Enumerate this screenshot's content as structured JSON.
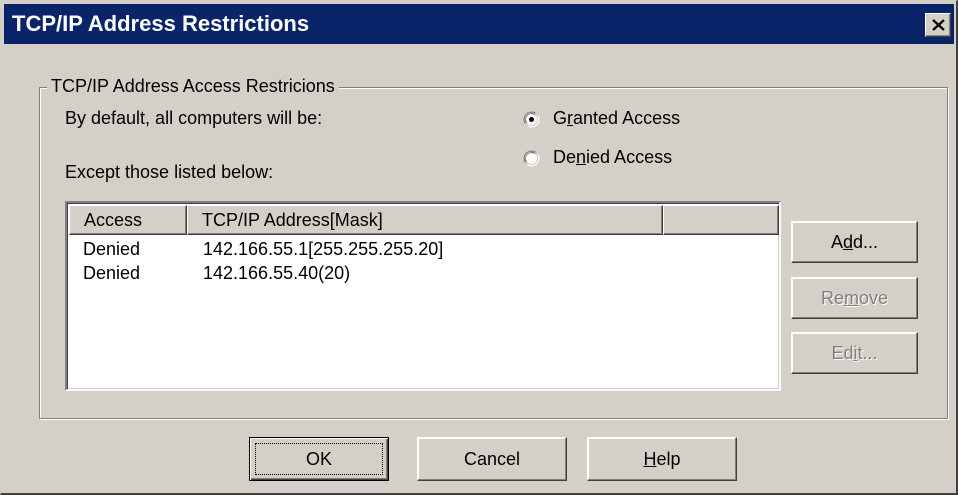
{
  "window": {
    "title": "TCP/IP Address Restrictions",
    "close_glyph": "close-icon"
  },
  "group": {
    "legend": "TCP/IP Address Access Restricions",
    "default_label": "By default, all computers will be:",
    "except_label": "Except those listed below:",
    "options": [
      {
        "label": "Granted Access",
        "mnemonic_prefix": "G",
        "mnemonic": "r",
        "mnemonic_suffix": "anted Access",
        "selected": true
      },
      {
        "label": "Denied Access",
        "mnemonic_prefix": "De",
        "mnemonic": "n",
        "mnemonic_suffix": "ied Access",
        "selected": false
      }
    ]
  },
  "list": {
    "columns": [
      "Access",
      "TCP/IP Address[Mask]",
      ""
    ],
    "rows": [
      {
        "access": "Denied",
        "address": "142.166.55.1[255.255.255.20]"
      },
      {
        "access": "Denied",
        "address": "142.166.55.40(20)"
      }
    ]
  },
  "side_buttons": {
    "add": {
      "pre": "A",
      "mn": "d",
      "post": "d...",
      "enabled": true
    },
    "remove": {
      "pre": "Re",
      "mn": "m",
      "post": "ove",
      "enabled": false
    },
    "edit": {
      "pre": "Ed",
      "mn": "i",
      "post": "t...",
      "enabled": false
    }
  },
  "footer": {
    "ok": "OK",
    "cancel": "Cancel",
    "help_mn": "H",
    "help_post": "elp"
  }
}
